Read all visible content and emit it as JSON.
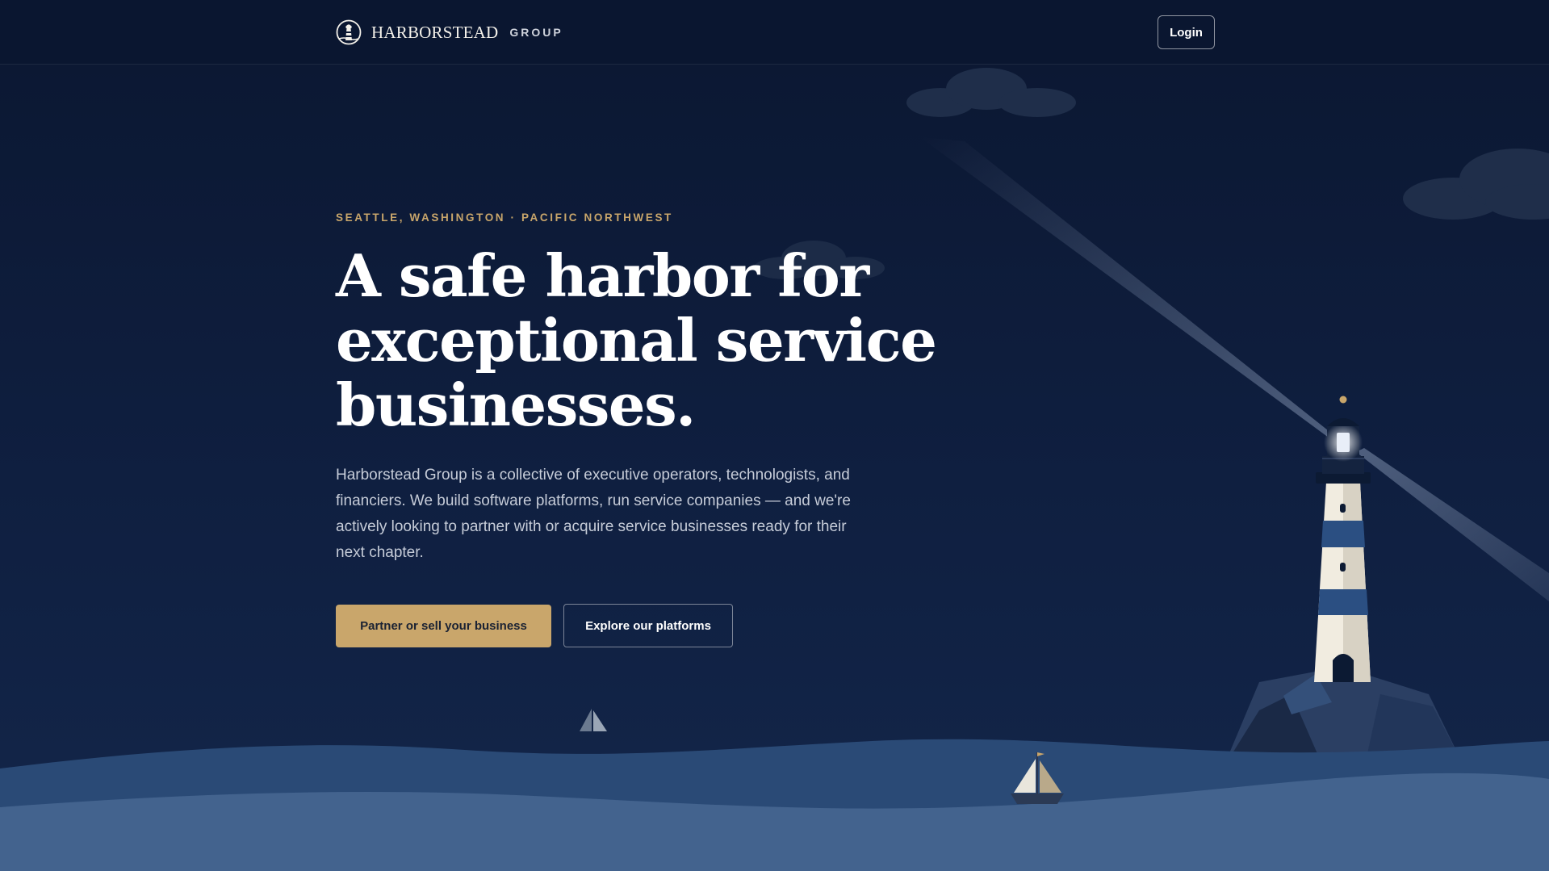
{
  "header": {
    "brand_name": "HARBORSTEAD",
    "brand_sub": "GROUP",
    "login_label": "Login"
  },
  "hero": {
    "eyebrow": "SEATTLE, WASHINGTON · PACIFIC NORTHWEST",
    "headline_lines": [
      "A safe harbor for",
      "exceptional service",
      "businesses."
    ],
    "lede": "Harborstead Group is a collective of executive operators, technologists, and financiers. We build software platforms, run service companies — and we're actively looking to partner with or acquire service businesses ready for their next chapter.",
    "primary_cta": "Partner or sell your business",
    "secondary_cta": "Explore our platforms"
  },
  "icons": [
    "lighthouse-logo-icon",
    "lighthouse",
    "sailboat",
    "cloud"
  ],
  "colors": {
    "background": "#0e1c38",
    "accent_gold": "#c9a66b",
    "sea_light": "#43638e",
    "sea_dark": "#2a4a76"
  }
}
